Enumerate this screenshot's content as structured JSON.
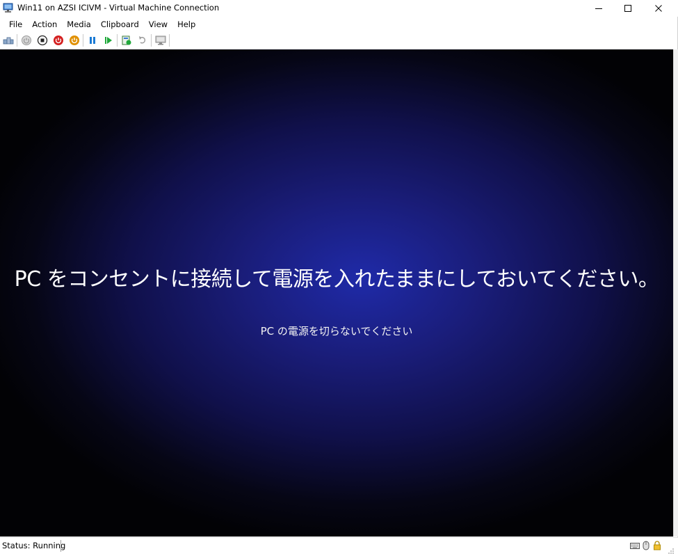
{
  "window": {
    "title": "Win11 on AZSI ICIVM - Virtual Machine Connection"
  },
  "menu": {
    "items": [
      "File",
      "Action",
      "Media",
      "Clipboard",
      "View",
      "Help"
    ]
  },
  "toolbar": {
    "buttons": [
      {
        "icon": "ctrl-alt-del-icon"
      },
      {
        "icon": "start-icon"
      },
      {
        "icon": "turn-off-icon"
      },
      {
        "icon": "shut-down-icon"
      },
      {
        "icon": "save-state-icon"
      },
      {
        "icon": "pause-icon"
      },
      {
        "icon": "resume-icon"
      },
      {
        "icon": "checkpoint-icon"
      },
      {
        "icon": "revert-icon"
      },
      {
        "icon": "enhanced-session-icon"
      }
    ]
  },
  "vm_screen": {
    "message": "PC をコンセントに接続して電源を入れたままにしておいてください。",
    "submessage": "PC の電源を切らないでください"
  },
  "status": {
    "text": "Status: Running"
  },
  "colors": {
    "screen_center": "#1f2aa8",
    "screen_edge": "#020205",
    "red_button": "#d42020",
    "orange_button": "#e09000",
    "blue_pause": "#1a7ad4",
    "green_play": "#1fa83a"
  }
}
